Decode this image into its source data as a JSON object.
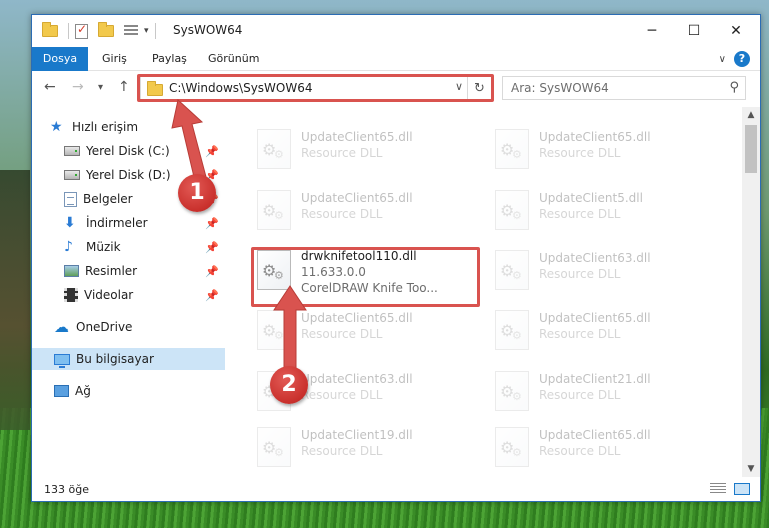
{
  "window": {
    "title": "SysWOW64",
    "controls": {
      "minimize": "─",
      "maximize": "☐",
      "close": "✕"
    }
  },
  "ribbon": {
    "tabs": [
      "Dosya",
      "Giriş",
      "Paylaş",
      "Görünüm"
    ],
    "active_tab": "Dosya",
    "colors": {
      "accent": "#1979ca"
    }
  },
  "navigation": {
    "back": "←",
    "forward": "→",
    "recent": "▾",
    "up": "↑",
    "address": "C:\\Windows\\SysWOW64",
    "refresh": "↻",
    "dropdown": "∨",
    "search_placeholder": "Ara: SysWOW64",
    "search_icon": "⚲"
  },
  "sidebar": {
    "items": [
      {
        "label": "Hızlı erişim",
        "icon": "star-icon",
        "pinned": false
      },
      {
        "label": "Yerel Disk (C:)",
        "icon": "drive-icon",
        "pinned": true
      },
      {
        "label": "Yerel Disk (D:)",
        "icon": "drive-icon",
        "pinned": true
      },
      {
        "label": "Belgeler",
        "icon": "document-icon",
        "pinned": true
      },
      {
        "label": "İndirmeler",
        "icon": "download-icon",
        "pinned": true
      },
      {
        "label": "Müzik",
        "icon": "music-icon",
        "pinned": true
      },
      {
        "label": "Resimler",
        "icon": "pictures-icon",
        "pinned": true
      },
      {
        "label": "Videolar",
        "icon": "video-icon",
        "pinned": true
      },
      {
        "label": "OneDrive",
        "icon": "cloud-icon",
        "pinned": false
      },
      {
        "label": "Bu bilgisayar",
        "icon": "computer-icon",
        "pinned": false,
        "selected": true
      },
      {
        "label": "Ağ",
        "icon": "network-icon",
        "pinned": false
      }
    ]
  },
  "files": {
    "left": [
      {
        "name": "UpdateClient65.dll",
        "desc": "Resource DLL"
      },
      {
        "name": "UpdateClient65.dll",
        "desc": "Resource DLL"
      },
      {
        "name": "drwknifetool110.dll",
        "version": "11.633.0.0",
        "desc": "CorelDRAW Knife Too..."
      },
      {
        "name": "UpdateClient65.dll",
        "desc": "Resource DLL"
      },
      {
        "name": "UpdateClient63.dll",
        "desc": "Resource DLL"
      },
      {
        "name": "UpdateClient19.dll",
        "desc": "Resource DLL"
      }
    ],
    "right": [
      {
        "name": "UpdateClient65.dll",
        "desc": "Resource DLL"
      },
      {
        "name": "UpdateClient5.dll",
        "desc": "Resource DLL"
      },
      {
        "name": "UpdateClient63.dll",
        "desc": "Resource DLL"
      },
      {
        "name": "UpdateClient65.dll",
        "desc": "Resource DLL"
      },
      {
        "name": "UpdateClient21.dll",
        "desc": "Resource DLL"
      },
      {
        "name": "UpdateClient65.dll",
        "desc": "Resource DLL"
      }
    ]
  },
  "status": {
    "item_count": "133 öğe"
  },
  "annotations": {
    "marker1": "1",
    "marker2": "2",
    "color": "#d9534f"
  }
}
